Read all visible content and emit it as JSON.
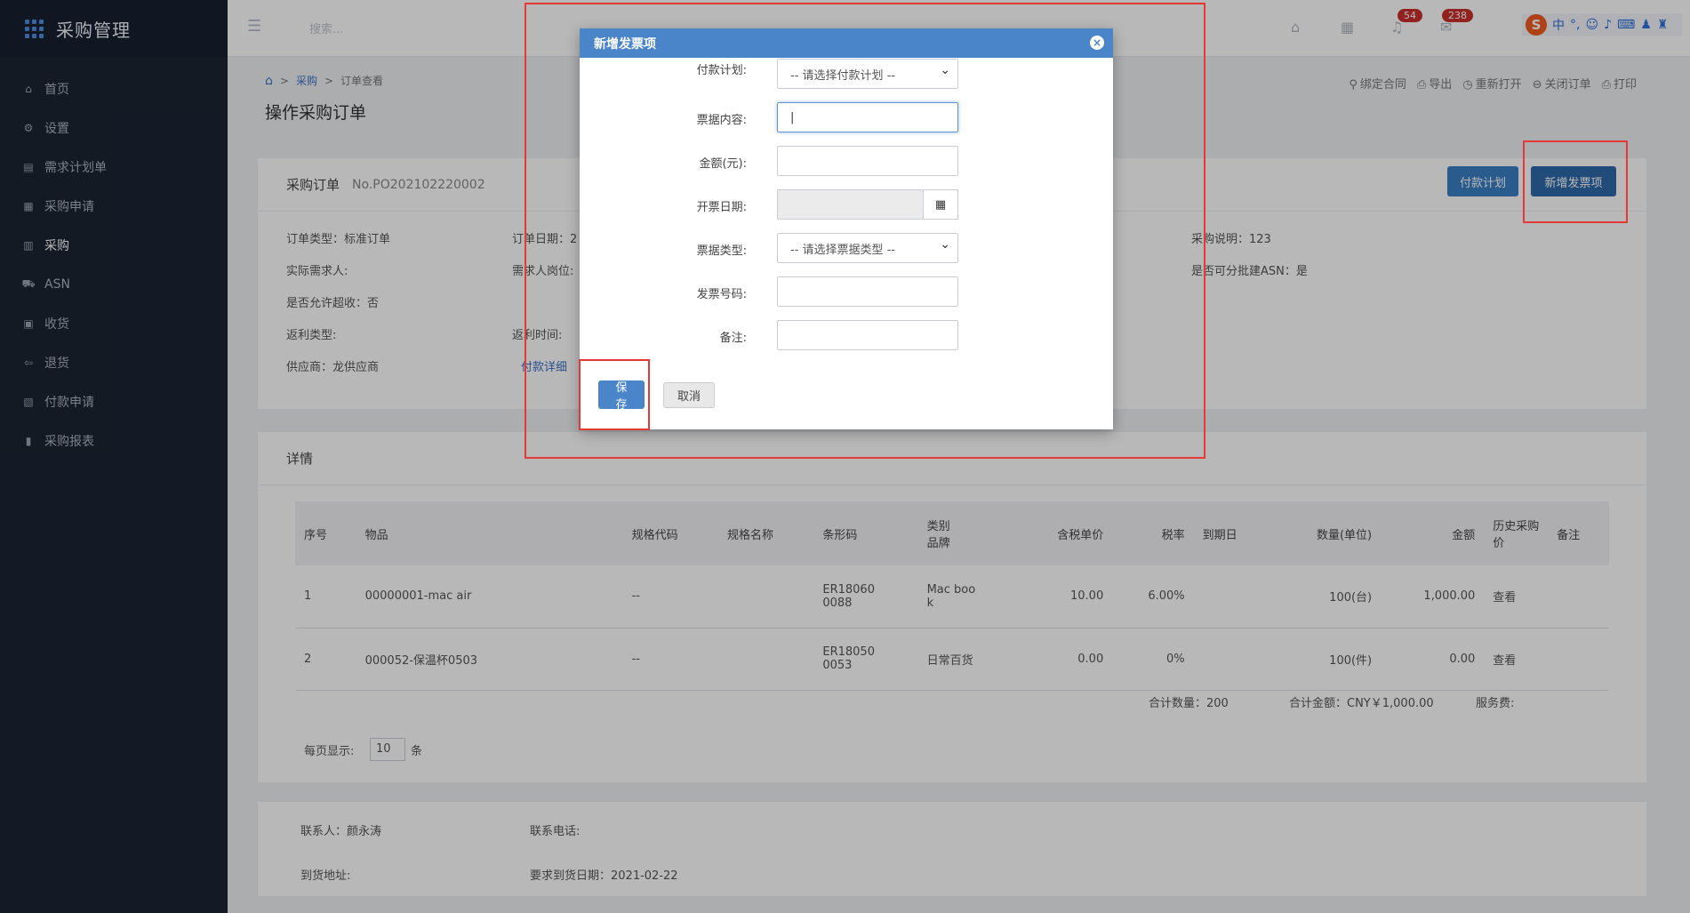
{
  "app": {
    "title": "采购管理"
  },
  "sidebar": {
    "items": [
      {
        "icon": "home-icon",
        "glyph": "⌂",
        "label": "首页"
      },
      {
        "icon": "gear-icon",
        "glyph": "⚙",
        "label": "设置"
      },
      {
        "icon": "document-icon",
        "glyph": "▤",
        "label": "需求计划单"
      },
      {
        "icon": "clipboard-icon",
        "glyph": "▦",
        "label": "采购申请"
      },
      {
        "icon": "list-icon",
        "glyph": "▥",
        "label": "采购"
      },
      {
        "icon": "truck-icon",
        "glyph": "⛟",
        "label": "ASN"
      },
      {
        "icon": "inbox-icon",
        "glyph": "▣",
        "label": "收货"
      },
      {
        "icon": "return-icon",
        "glyph": "⇦",
        "label": "退货"
      },
      {
        "icon": "payment-icon",
        "glyph": "▧",
        "label": "付款申请"
      },
      {
        "icon": "bar-chart-icon",
        "glyph": "▮",
        "label": "采购报表"
      }
    ]
  },
  "header": {
    "search_placeholder": "搜索...",
    "notifications_count": "54",
    "messages_count": "238"
  },
  "breadcrumb": {
    "root": "采购",
    "current": "订单查看"
  },
  "page_title": "操作采购订单",
  "page_actions": [
    {
      "icon": "link-icon",
      "glyph": "⚲",
      "label": "绑定合同"
    },
    {
      "icon": "export-icon",
      "glyph": "⎙",
      "label": "导出"
    },
    {
      "icon": "reopen-icon",
      "glyph": "◷",
      "label": "重新打开"
    },
    {
      "icon": "close-order-icon",
      "glyph": "⊖",
      "label": "关闭订单"
    },
    {
      "icon": "print-icon",
      "glyph": "⎙",
      "label": "打印"
    }
  ],
  "order": {
    "heading": "采购订单",
    "number": "No.PO202102220002",
    "btn_payment_plan": "付款计划",
    "btn_add_invoice": "新增发票项",
    "fields": {
      "type": "订单类型：标准订单",
      "date": "订单日期：2",
      "desc": "采购说明：123",
      "requester": "实际需求人:",
      "req_position": "需求人岗位:",
      "batch_asn": "是否可分批建ASN：是",
      "over_receive": "是否允许超收：否",
      "rebate_type": "返利类型:",
      "rebate_time": "返利时间:",
      "supplier": "供应商：龙供应商",
      "payment_detail": "付款详细"
    }
  },
  "details": {
    "heading": "详情",
    "columns": [
      "序号",
      "物品",
      "规格代码",
      "规格名称",
      "条形码",
      "类别\n品牌",
      "含税单价",
      "税率",
      "到期日",
      "数量(单位)",
      "金额",
      "历史采购价",
      "备注"
    ],
    "rows": [
      {
        "no": "1",
        "item": "00000001-mac air",
        "spec_code": "--",
        "spec_name": "",
        "barcode": "ER18060\n0088",
        "category": "Mac boo\nk",
        "price": "10.00",
        "tax": "6.00%",
        "due": "",
        "qty": "100(台)",
        "amount": "1,000.00",
        "history": "查看",
        "remark": ""
      },
      {
        "no": "2",
        "item": "000052-保温杯0503",
        "spec_code": "--",
        "spec_name": "",
        "barcode": "ER18050\n0053",
        "category": "日常百货",
        "price": "0.00",
        "tax": "0%",
        "due": "",
        "qty": "100(件)",
        "amount": "0.00",
        "history": "查看",
        "remark": ""
      }
    ],
    "total_qty": "合计数量：200",
    "total_amount": "合计金额：CNY￥1,000.00",
    "service_fee": "服务费:",
    "page_size_label": "每页显示:",
    "page_size": "10",
    "page_size_unit": "条"
  },
  "contact": {
    "person": "联系人：颜永涛",
    "phone": "联系电话:",
    "address": "到货地址:",
    "deliver_date": "要求到货日期：2021-02-22"
  },
  "modal": {
    "title": "新增发票项",
    "payment_plan_label": "付款计划:",
    "payment_plan_value": "-- 请选择付款计划 --",
    "content_label": "票据内容:",
    "amount_label": "金额(元):",
    "date_label": "开票日期:",
    "type_label": "票据类型:",
    "type_value": "-- 请选择票据类型 --",
    "invoice_no_label": "发票号码:",
    "remark_label": "备注:",
    "save": "保存",
    "cancel": "取消"
  },
  "colors": {
    "sidebar_bg": "#1b2433",
    "modal_header": "#4a84c9",
    "primary": "#3a7fc4",
    "highlight": "#e53935",
    "badge": "#c9302c"
  }
}
